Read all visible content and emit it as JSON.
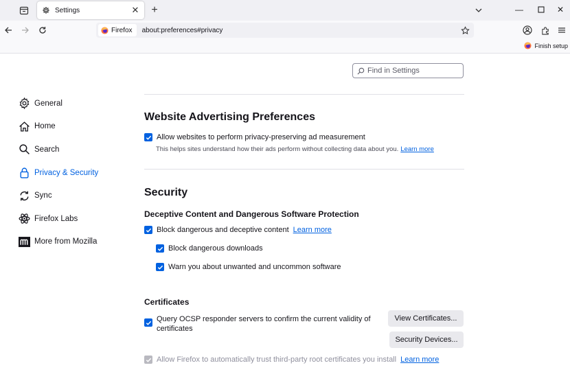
{
  "tabs": [
    {
      "title": "Settings",
      "icon": "gear-icon"
    }
  ],
  "urlbar": {
    "identity_label": "Firefox",
    "url": "about:preferences#privacy"
  },
  "finish_setup": "Finish setup",
  "search": {
    "placeholder": "Find in Settings"
  },
  "sidebar": {
    "items": [
      {
        "label": "General",
        "icon": "gear-icon"
      },
      {
        "label": "Home",
        "icon": "home-icon"
      },
      {
        "label": "Search",
        "icon": "search-icon"
      },
      {
        "label": "Privacy & Security",
        "icon": "lock-icon",
        "active": true
      },
      {
        "label": "Sync",
        "icon": "sync-icon"
      },
      {
        "label": "Firefox Labs",
        "icon": "labs-icon"
      },
      {
        "label": "More from Mozilla",
        "icon": "mozilla-icon"
      }
    ]
  },
  "ads": {
    "title": "Website Advertising Preferences",
    "checkbox_label": "Allow websites to perform privacy-preserving ad measurement",
    "hint": "This helps sites understand how their ads perform without collecting data about you.",
    "learn_more": "Learn more"
  },
  "security": {
    "title": "Security",
    "deceptive": {
      "title": "Deceptive Content and Dangerous Software Protection",
      "block_label": "Block dangerous and deceptive content",
      "learn_more": "Learn more",
      "downloads_label": "Block dangerous downloads",
      "uncommon_label": "Warn you about unwanted and uncommon software"
    },
    "certificates": {
      "title": "Certificates",
      "ocsp_label": "Query OCSP responder servers to confirm the current validity of certificates",
      "view_button": "View Certificates...",
      "devices_button": "Security Devices...",
      "trust_label": "Allow Firefox to automatically trust third-party root certificates you install",
      "learn_more": "Learn more"
    }
  },
  "colors": {
    "accent": "#0061e0"
  }
}
